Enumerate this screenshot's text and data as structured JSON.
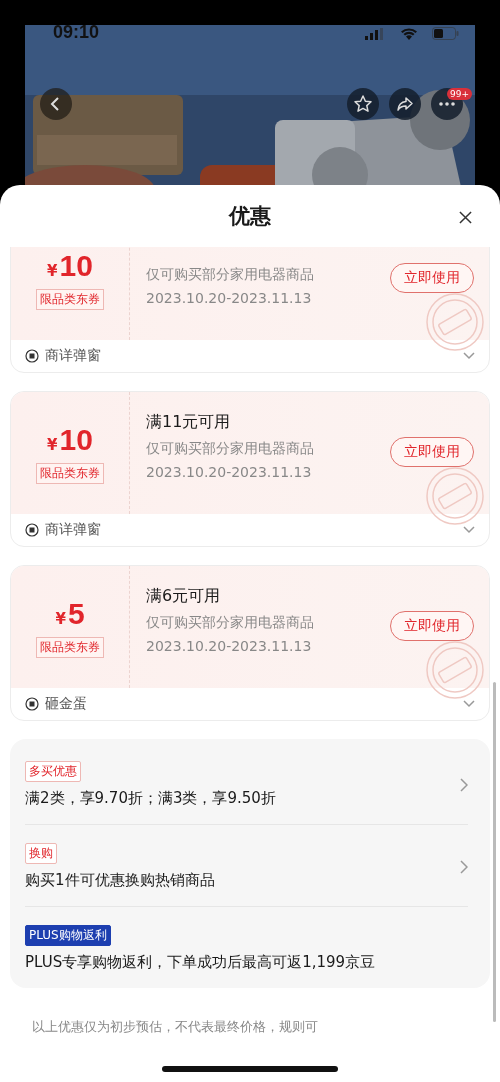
{
  "status_bar": {
    "time": "09:10"
  },
  "banner": {
    "kind": "picture",
    "more_badge": "99+"
  },
  "sheet": {
    "title": "优惠"
  },
  "coupons": [
    {
      "currency": "¥",
      "amount": "10",
      "tag": "限品类东券",
      "desc": "仅可购买部分家用电器商品",
      "validity": "2023.10.20-2023.11.13",
      "button": "立即使用",
      "source": "商详弹窗"
    },
    {
      "currency": "¥",
      "amount": "10",
      "tag": "限品类东券",
      "title": "满11元可用",
      "desc": "仅可购买部分家用电器商品",
      "validity": "2023.10.20-2023.11.13",
      "button": "立即使用",
      "source": "商详弹窗"
    },
    {
      "currency": "¥",
      "amount": "5",
      "tag": "限品类东券",
      "title": "满6元可用",
      "desc": "仅可购买部分家用电器商品",
      "validity": "2023.10.20-2023.11.13",
      "button": "立即使用",
      "source": "砸金蛋"
    }
  ],
  "offers": [
    {
      "kind": "red",
      "tag": "多买优惠",
      "text": "满2类，享9.70折；满3类，享9.50折",
      "arrow": true
    },
    {
      "kind": "red",
      "tag": "换购",
      "text": "购买1件可优惠换购热销商品",
      "arrow": true
    },
    {
      "kind": "plus",
      "tag": "PLUS购物返利",
      "text": "PLUS专享购物返利，下单成功后最高可返1,199京豆",
      "arrow": false
    }
  ],
  "note": "以上优惠仅为初步预估，不代表最终价格，规则可"
}
